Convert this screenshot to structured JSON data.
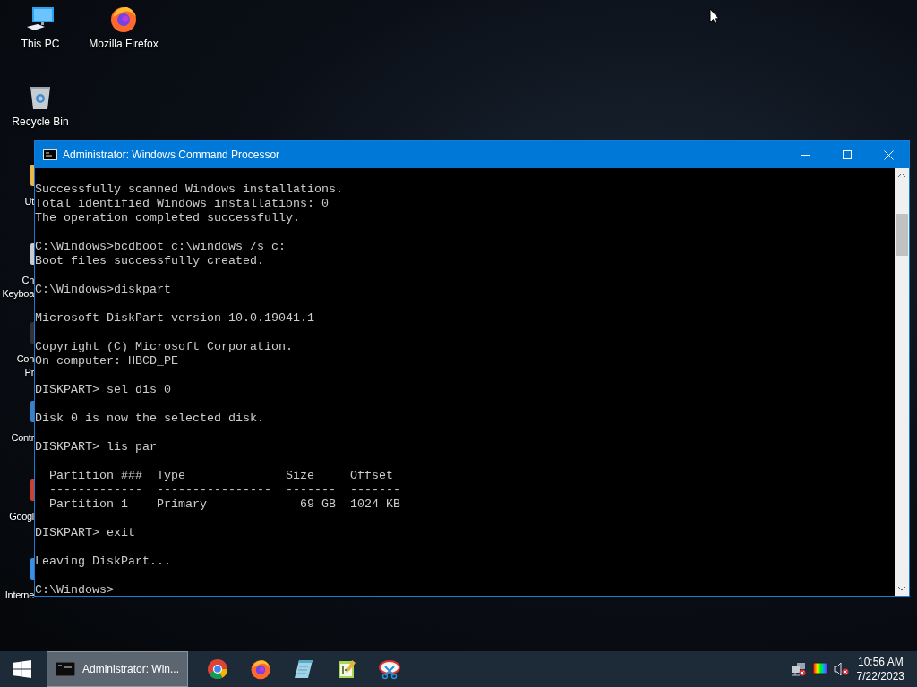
{
  "desktop_icons": [
    {
      "label": "This PC",
      "kind": "pc"
    },
    {
      "label": "Mozilla Firefox",
      "kind": "firefox"
    },
    {
      "label": "Recycle Bin",
      "kind": "bin"
    }
  ],
  "covered_desktop_icons": [
    {
      "lines": [
        "Ut"
      ],
      "kind": "folder"
    },
    {
      "lines": [
        "Ch",
        "Keyboa"
      ],
      "kind": "keyboard"
    },
    {
      "lines": [
        "Con",
        "Pr"
      ],
      "kind": "console"
    },
    {
      "lines": [
        "Contr"
      ],
      "kind": "control"
    },
    {
      "lines": [
        "Googl"
      ],
      "kind": "chrome"
    },
    {
      "lines": [
        "Interne"
      ],
      "kind": "ie"
    }
  ],
  "window": {
    "title": "Administrator: Windows Command Processor",
    "console_blocks": [
      [
        "Successfully scanned Windows installations.",
        "Total identified Windows installations: 0",
        "The operation completed successfully."
      ],
      [
        "C:\\Windows>bcdboot c:\\windows /s c:",
        "Boot files successfully created."
      ],
      [
        "C:\\Windows>diskpart"
      ],
      [
        "Microsoft DiskPart version 10.0.19041.1"
      ],
      [
        "Copyright (C) Microsoft Corporation.",
        "On computer: HBCD_PE"
      ],
      [
        "DISKPART> sel dis 0"
      ],
      [
        "Disk 0 is now the selected disk."
      ],
      [
        "DISKPART> lis par"
      ],
      [
        "  Partition ###  Type              Size     Offset",
        "  -------------  ----------------  -------  -------",
        "  Partition 1    Primary             69 GB  1024 KB"
      ],
      [
        "DISKPART> exit"
      ],
      [
        "Leaving DiskPart..."
      ],
      [
        "C:\\Windows>"
      ]
    ]
  },
  "taskbar": {
    "task_buttons": [
      {
        "label": "Administrator: Win...",
        "selected": true
      }
    ],
    "pinned": [
      {
        "kind": "chrome"
      },
      {
        "kind": "firefox"
      },
      {
        "kind": "notepad"
      },
      {
        "kind": "editor"
      },
      {
        "kind": "snip"
      }
    ],
    "tray": [
      {
        "kind": "network"
      },
      {
        "kind": "display"
      },
      {
        "kind": "volume"
      }
    ],
    "time": "10:56 AM",
    "date": "7/22/2023"
  }
}
